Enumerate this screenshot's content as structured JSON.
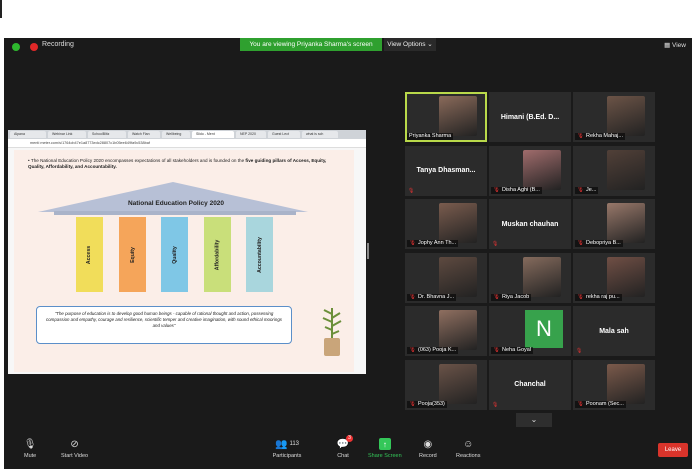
{
  "recording_label": "Recording",
  "share_banner": "You are viewing Priyanka Sharma's screen",
  "view_options": "View Options ⌄",
  "view_button": "View",
  "browser": {
    "tabs": [
      "Alpana",
      "Webinar Link",
      "SchoolBlitz",
      "Watch Flan",
      "Wellbeing",
      "Slido - Ment",
      "NEP 2020",
      "Guest Lect",
      "what is sch"
    ],
    "url": "menti meter.com/s/1764cb47e1a8773edc28807c1b05ee649fa9c538baf"
  },
  "slide": {
    "bullet_plain": "The National Education Policy 2020 encompasses expectations of all stakeholders and is founded on the ",
    "bullet_bold": "five guiding pillars of Access, Equity, Quality, Affordability, and Accountability.",
    "roof_title": "National Education Policy 2020",
    "pillars": [
      "Access",
      "Equity",
      "Quality",
      "Affordability",
      "Accountability"
    ],
    "pillar_colors": [
      "#f1dd5a",
      "#f5a55a",
      "#7fc7e6",
      "#c9df7a",
      "#a9d6dd"
    ],
    "quote": "\"The purpose of education is to develop good human beings - capable of rational thought and action, possessing compassion and empathy, courage and resilience, scientific temper and creative imagination, with sound ethical moorings and values\""
  },
  "participants": [
    {
      "name": "Priyanka Sharma",
      "type": "photo",
      "muted": false
    },
    {
      "name": "Himani (B.Ed. D...",
      "type": "name",
      "muted": false
    },
    {
      "name": "Rekha Mahaj...",
      "type": "photo",
      "muted": true
    },
    {
      "name": "Tanya Dhasman...",
      "type": "name",
      "muted": true
    },
    {
      "name": "Disha Aghi (B...",
      "type": "photo",
      "muted": true
    },
    {
      "name": "Je...",
      "type": "photo",
      "muted": true
    },
    {
      "name": "Jophy Ann Th...",
      "type": "photo",
      "muted": true
    },
    {
      "name": "Muskan chauhan",
      "type": "name",
      "muted": true
    },
    {
      "name": "Debopriya B...",
      "type": "photo",
      "muted": true
    },
    {
      "name": "Dr. Bhavna J...",
      "type": "photo",
      "muted": true
    },
    {
      "name": "Riya Jacob",
      "type": "photo",
      "muted": true
    },
    {
      "name": "rekha raj pu...",
      "type": "photo",
      "muted": true
    },
    {
      "name": "(063) Pooja K...",
      "type": "photo",
      "muted": true
    },
    {
      "name": "Neha Goyal",
      "type": "avatar",
      "initial": "N",
      "muted": true
    },
    {
      "name": "Mala sah",
      "type": "name",
      "muted": true
    },
    {
      "name": "Pooja(353)",
      "type": "photo",
      "muted": true
    },
    {
      "name": "Chanchal",
      "type": "name",
      "muted": true
    },
    {
      "name": "Poonam (Sec...",
      "type": "photo",
      "muted": true
    }
  ],
  "toolbar": {
    "mute": "Mute",
    "start_video": "Start Video",
    "participants": "Participants",
    "participants_count": "113",
    "chat": "Chat",
    "chat_badge": "3",
    "share_screen": "Share Screen",
    "record": "Record",
    "reactions": "Reactions",
    "leave": "Leave"
  },
  "colors": {
    "accent_green": "#2fa02f",
    "share_green": "#34c759",
    "leave_red": "#d9342b",
    "active_speaker": "#b9d94a"
  }
}
